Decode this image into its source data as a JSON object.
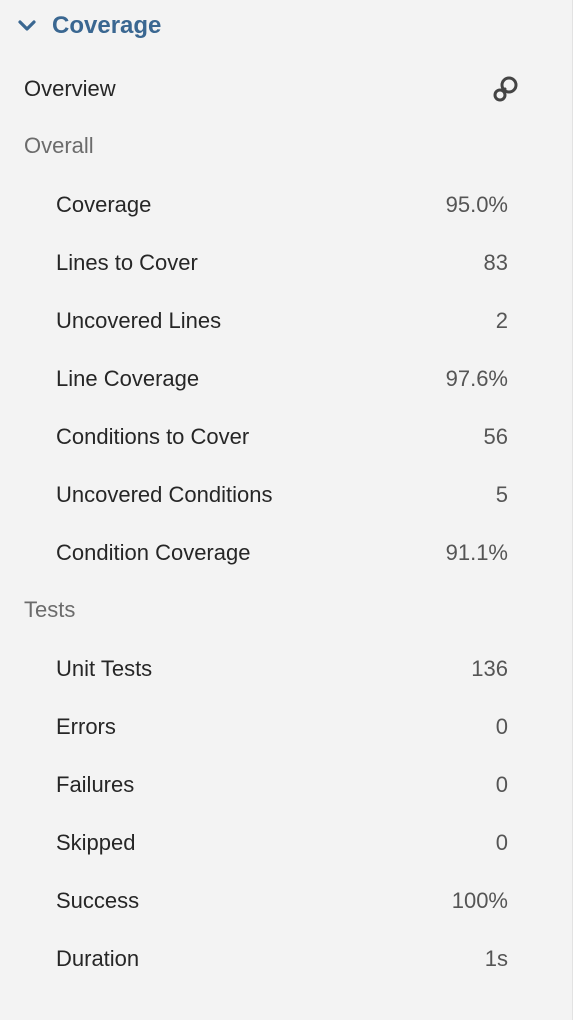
{
  "section": {
    "title": "Coverage"
  },
  "overview": {
    "label": "Overview",
    "icon": "link-icon"
  },
  "overall": {
    "label": "Overall",
    "metrics": [
      {
        "label": "Coverage",
        "value": "95.0%"
      },
      {
        "label": "Lines to Cover",
        "value": "83"
      },
      {
        "label": "Uncovered Lines",
        "value": "2"
      },
      {
        "label": "Line Coverage",
        "value": "97.6%"
      },
      {
        "label": "Conditions to Cover",
        "value": "56"
      },
      {
        "label": "Uncovered Conditions",
        "value": "5"
      },
      {
        "label": "Condition Coverage",
        "value": "91.1%"
      }
    ]
  },
  "tests": {
    "label": "Tests",
    "metrics": [
      {
        "label": "Unit Tests",
        "value": "136"
      },
      {
        "label": "Errors",
        "value": "0"
      },
      {
        "label": "Failures",
        "value": "0"
      },
      {
        "label": "Skipped",
        "value": "0"
      },
      {
        "label": "Success",
        "value": "100%"
      },
      {
        "label": "Duration",
        "value": "1s"
      }
    ]
  },
  "colors": {
    "accent": "#3a6791",
    "panel_bg": "#f3f3f3",
    "text": "#262626",
    "muted": "#6b6b6b"
  }
}
